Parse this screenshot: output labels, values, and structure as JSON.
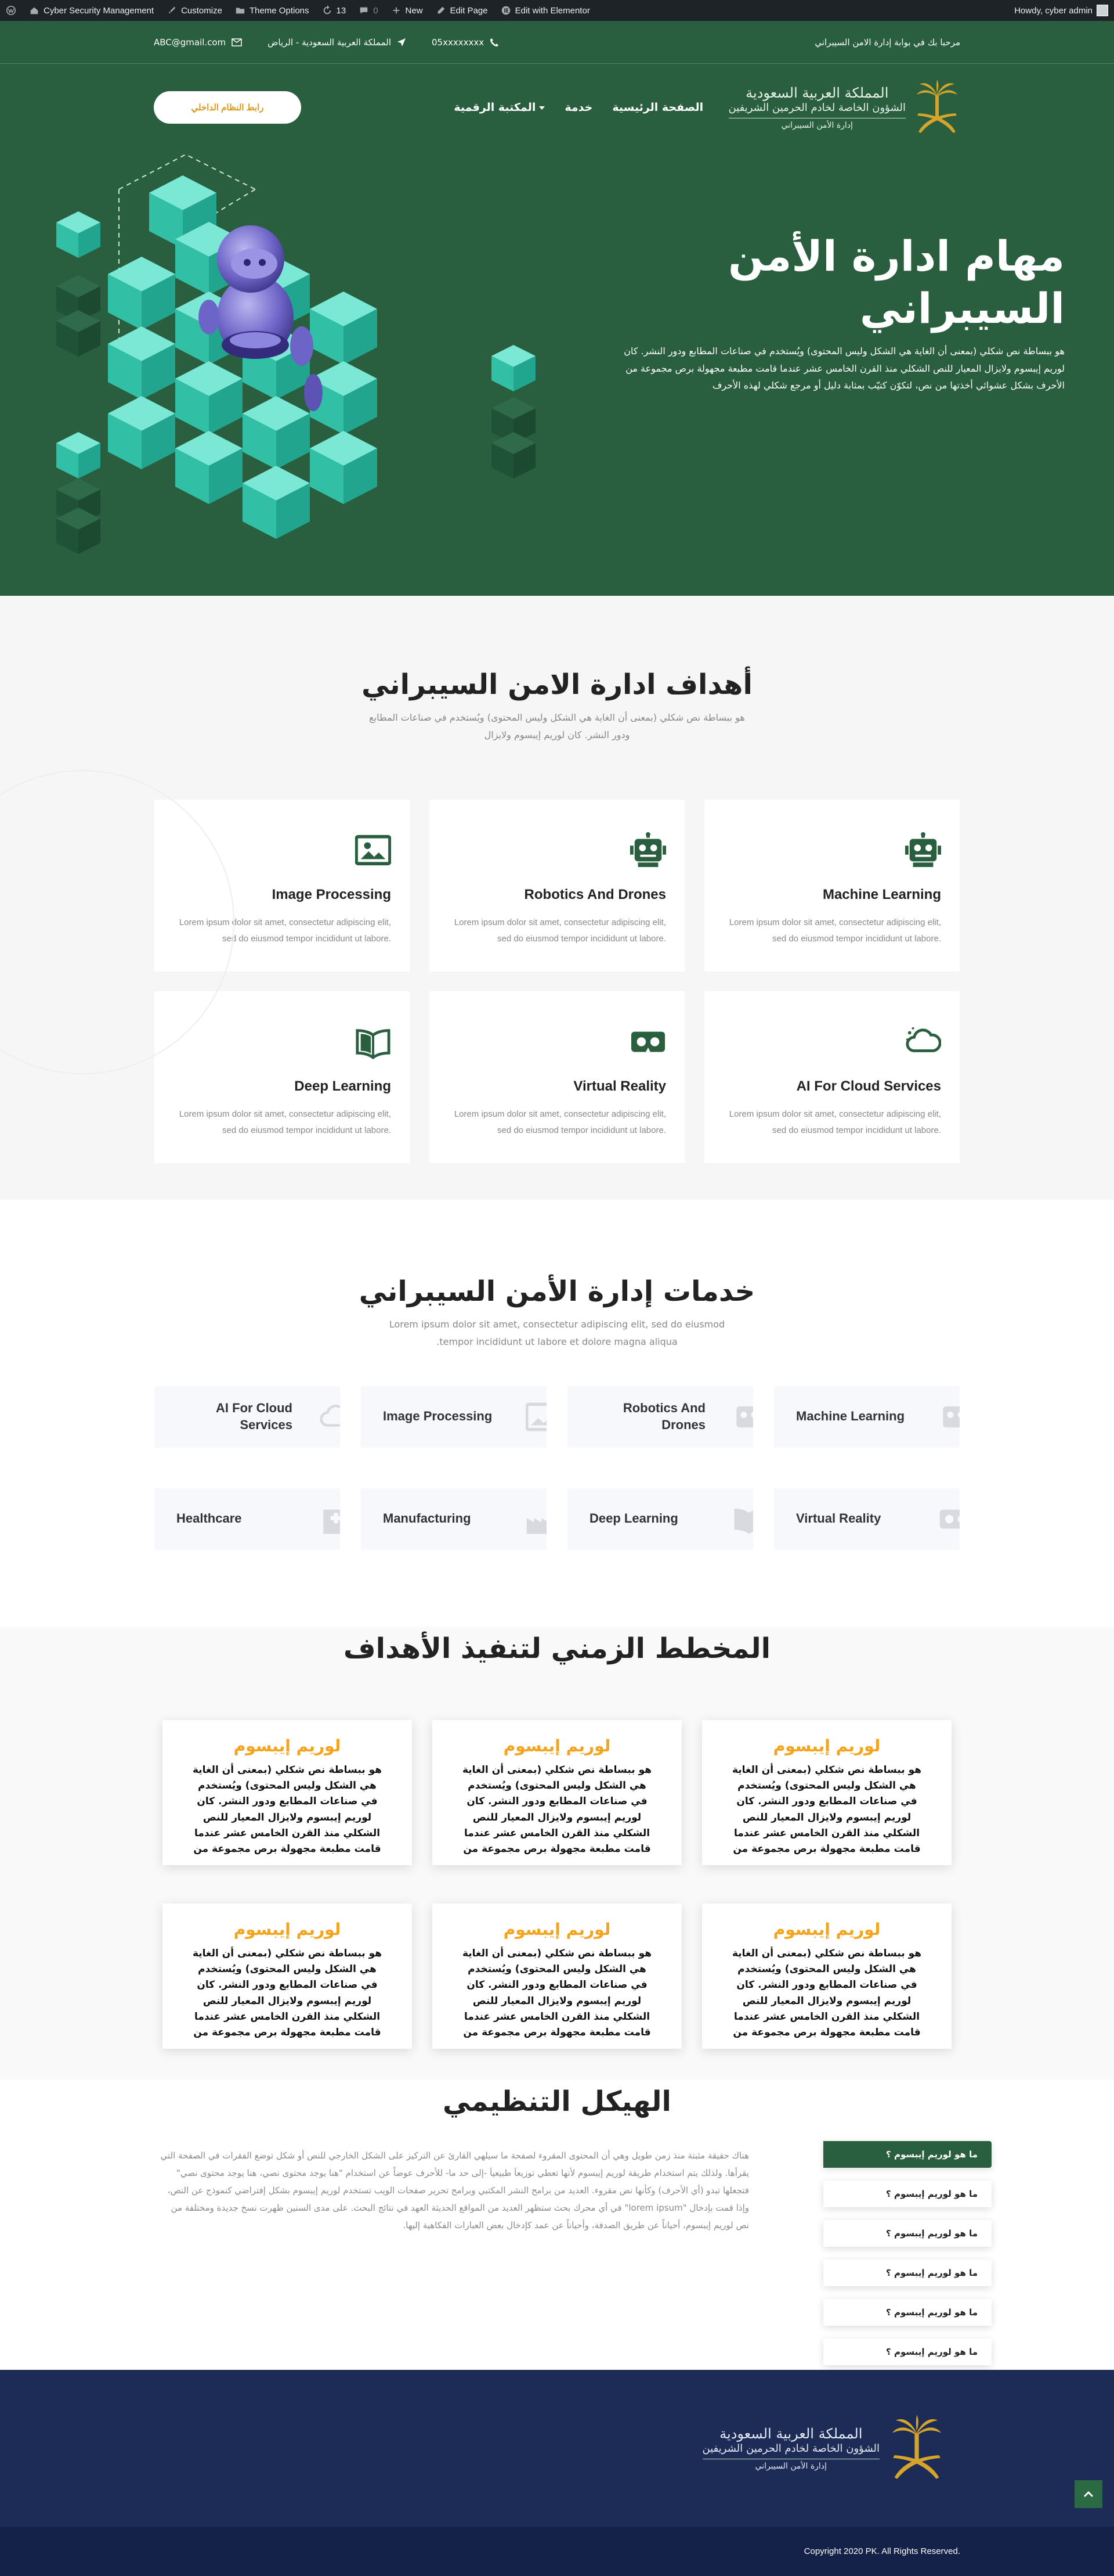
{
  "admin_bar": {
    "site_name": "Cyber Security Management",
    "customize": "Customize",
    "theme_options": "Theme Options",
    "updates_count": "13",
    "comments_count": "0",
    "new_label": "New",
    "edit_page": "Edit Page",
    "edit_elementor": "Edit with Elementor",
    "howdy": "Howdy, cyber admin"
  },
  "topbar": {
    "welcome": "مرحبا بك في بوابة إدارة الامن السيبراني",
    "phone": "05xxxxxxxx",
    "location": "المملكة العربية السعودية - الرياض",
    "email": "ABC@gmail.com"
  },
  "nav": {
    "home": "الصفحة الرئيسية",
    "service": "خدمة",
    "library": "المكتبة الرقمية",
    "login_button": "رابط النظام الداخلي"
  },
  "logo": {
    "line1": "المملكة العربية السعودية",
    "line2": "الشؤون الخاصة لخادم الحرمين الشريفين",
    "line3": "إدارة الأمن السيبراني"
  },
  "hero": {
    "title": "مهام ادارة الأمن السيبراني",
    "text": "هو ببساطة نص شكلي (بمعنى أن الغاية هي الشكل وليس المحتوى) ويُستخدم في صناعات المطابع ودور النشر. كان لوريم إيبسوم ولايزال المعيار للنص الشكلي منذ القرن الخامس عشر عندما قامت مطبعة مجهولة برص مجموعة من الأحرف بشكل عشوائي أخذتها من نص، لتكوّن كتيّب بمثابة دليل أو مرجع شكلي لهذه الأحرف"
  },
  "goals": {
    "title": "أهداف ادارة الامن السيبراني",
    "subtitle": "هو ببساطة نص شكلي (بمعنى أن الغاية هي الشكل وليس المحتوى) ويُستخدم في صناعات المطابع ودور النشر. كان لوريم إيبسوم ولايزال",
    "cards": [
      {
        "title": "Machine Learning",
        "text": "Lorem ipsum dolor sit amet, consectetur adipiscing elit, sed do eiusmod tempor incididunt ut labore.",
        "icon": "robot-icon"
      },
      {
        "title": "Robotics And Drones",
        "text": "Lorem ipsum dolor sit amet, consectetur adipiscing elit, sed do eiusmod tempor incididunt ut labore.",
        "icon": "robot-icon"
      },
      {
        "title": "Image Processing",
        "text": "Lorem ipsum dolor sit amet, consectetur adipiscing elit, sed do eiusmod tempor incididunt ut labore.",
        "icon": "image-icon"
      },
      {
        "title": "AI For Cloud Services",
        "text": "Lorem ipsum dolor sit amet, consectetur adipiscing elit, sed do eiusmod tempor incididunt ut labore.",
        "icon": "cloud-icon"
      },
      {
        "title": "Virtual Reality",
        "text": "Lorem ipsum dolor sit amet, consectetur adipiscing elit, sed do eiusmod tempor incididunt ut labore.",
        "icon": "vr-headset-icon"
      },
      {
        "title": "Deep Learning",
        "text": "Lorem ipsum dolor sit amet, consectetur adipiscing elit, sed do eiusmod tempor incididunt ut labore.",
        "icon": "book-icon"
      }
    ],
    "accent_color": "#295e3f"
  },
  "services": {
    "title": "خدمات إدارة الأمن السيبراني",
    "subtitle": "Lorem ipsum dolor sit amet, consectetur adipiscing elit, sed do eiusmod tempor incididunt ut labore et dolore magna aliqua.",
    "items": [
      {
        "label": "Machine Learning",
        "icon": "robot-icon"
      },
      {
        "label": "Robotics And Drones",
        "icon": "robot-icon"
      },
      {
        "label": "Image Processing",
        "icon": "image-icon"
      },
      {
        "label": "AI For Cloud Services",
        "icon": "cloud-icon"
      },
      {
        "label": "Virtual Reality",
        "icon": "vr-headset-icon"
      },
      {
        "label": "Deep Learning",
        "icon": "book-icon"
      },
      {
        "label": "Manufacturing",
        "icon": "factory-icon"
      },
      {
        "label": "Healthcare",
        "icon": "hospital-icon"
      }
    ]
  },
  "timeline": {
    "title": "المخطط الزمني لتنفيذ الأهداف",
    "cards": [
      {
        "title": "لوريم إيبسوم",
        "text": "هو ببساطة نص شكلي (بمعنى أن الغاية هي الشكل وليس المحتوى) ويُستخدم في صناعات المطابع ودور النشر. كان لوريم إيبسوم ولايزال المعيار للنص الشكلي منذ القرن الخامس عشر عندما قامت مطبعة مجهولة برص مجموعة من"
      },
      {
        "title": "لوريم إيبسوم",
        "text": "هو ببساطة نص شكلي (بمعنى أن الغاية هي الشكل وليس المحتوى) ويُستخدم في صناعات المطابع ودور النشر. كان لوريم إيبسوم ولايزال المعيار للنص الشكلي منذ القرن الخامس عشر عندما قامت مطبعة مجهولة برص مجموعة من"
      },
      {
        "title": "لوريم إيبسوم",
        "text": "هو ببساطة نص شكلي (بمعنى أن الغاية هي الشكل وليس المحتوى) ويُستخدم في صناعات المطابع ودور النشر. كان لوريم إيبسوم ولايزال المعيار للنص الشكلي منذ القرن الخامس عشر عندما قامت مطبعة مجهولة برص مجموعة من"
      },
      {
        "title": "لوريم إيبسوم",
        "text": "هو ببساطة نص شكلي (بمعنى أن الغاية هي الشكل وليس المحتوى) ويُستخدم في صناعات المطابع ودور النشر. كان لوريم إيبسوم ولايزال المعيار للنص الشكلي منذ القرن الخامس عشر عندما قامت مطبعة مجهولة برص مجموعة من"
      },
      {
        "title": "لوريم إيبسوم",
        "text": "هو ببساطة نص شكلي (بمعنى أن الغاية هي الشكل وليس المحتوى) ويُستخدم في صناعات المطابع ودور النشر. كان لوريم إيبسوم ولايزال المعيار للنص الشكلي منذ القرن الخامس عشر عندما قامت مطبعة مجهولة برص مجموعة من"
      },
      {
        "title": "لوريم إيبسوم",
        "text": "هو ببساطة نص شكلي (بمعنى أن الغاية هي الشكل وليس المحتوى) ويُستخدم في صناعات المطابع ودور النشر. كان لوريم إيبسوم ولايزال المعيار للنص الشكلي منذ القرن الخامس عشر عندما قامت مطبعة مجهولة برص مجموعة من"
      }
    ],
    "title_color": "#f5a31a"
  },
  "org": {
    "title": "الهيكل التنظيمي",
    "items": [
      "ما هو لوريم إيبسوم ؟",
      "ما هو لوريم إيبسوم ؟",
      "ما هو لوريم إيبسوم ؟",
      "ما هو لوريم إيبسوم ؟",
      "ما هو لوريم إيبسوم ؟",
      "ما هو لوريم إيبسوم ؟"
    ],
    "text": "هناك حقيقة مثبتة منذ زمن طويل وهي أن المحتوى المقروء لصفحة ما سيلهي القارئ عن التركيز على الشكل الخارجي للنص أو شكل توضع الفقرات في الصفحة التي يقرأها. ولذلك يتم استخدام طريقة لوريم إيبسوم لأنها تعطي توزيعاَ طبيعياَ -إلى حد ما- للأحرف عوضاً عن استخدام \"هنا يوجد محتوى نصي، هنا يوجد محتوى نصي\" فتجعلها تبدو (أي الأحرف) وكأنها نص مقروء. العديد من برامح النشر المكتبي وبرامح تحرير صفحات الويب تستخدم لوريم إيبسوم بشكل إفتراضي كنموذج عن النص، وإذا قمت بإدخال \"lorem ipsum\" في أي محرك بحث ستظهر العديد من المواقع الحديثة العهد في نتائج البحث. على مدى السنين ظهرت نسخ جديدة ومختلفة من نص لوريم إيبسوم، أحياناً عن طريق الصدفة، وأحياناً عن عمد كإدخال بعض العبارات الفكاهية إليها."
  },
  "footer": {
    "copyright": "Copyright 2020 PK. All Rights Reserved."
  },
  "colors": {
    "primary_green": "#295e3f",
    "footer_navy": "#1d2b57",
    "accent_orange": "#f5a31a",
    "teal_cube": "#37c3ad"
  }
}
